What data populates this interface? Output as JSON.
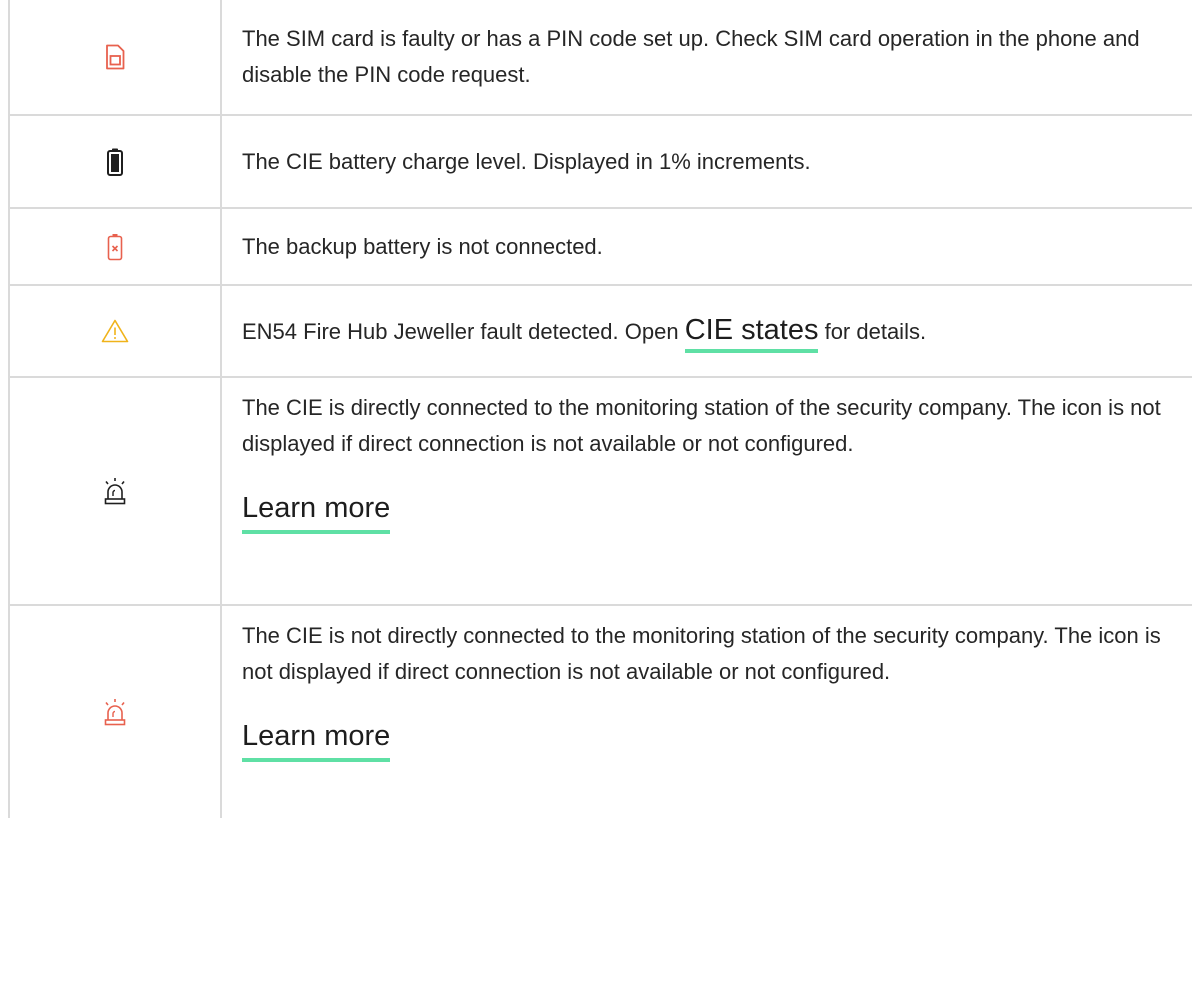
{
  "rows": [
    {
      "icon": "sim-card-faulty-icon",
      "icon_color": "#e8614e",
      "text": "The SIM card is faulty or has a PIN code set up. Check SIM card operation in the phone and disable the PIN code request."
    },
    {
      "icon": "battery-full-icon",
      "icon_color": "#1f1f1f",
      "text": "The CIE battery charge level. Displayed in 1% increments."
    },
    {
      "icon": "battery-disconnected-icon",
      "icon_color": "#e8614e",
      "text": "The backup battery is not connected."
    },
    {
      "icon": "warning-triangle-icon",
      "icon_color": "#f0b31a",
      "text_before": "EN54 Fire Hub Jeweller fault detected. Open ",
      "link": "CIE states",
      "text_after": " for details."
    },
    {
      "icon": "siren-connected-icon",
      "icon_color": "#1f1f1f",
      "text": "The CIE is directly connected to the monitoring station of the security company. The icon is not displayed if direct connection is not available or not configured.",
      "link": "Learn more"
    },
    {
      "icon": "siren-not-connected-icon",
      "icon_color": "#e8614e",
      "text": "The CIE is not directly connected to the monitoring station of the security company. The icon is not displayed if direct connection is not available or not configured.",
      "link": "Learn more"
    }
  ],
  "link_underline_color": "#5fe0a5"
}
